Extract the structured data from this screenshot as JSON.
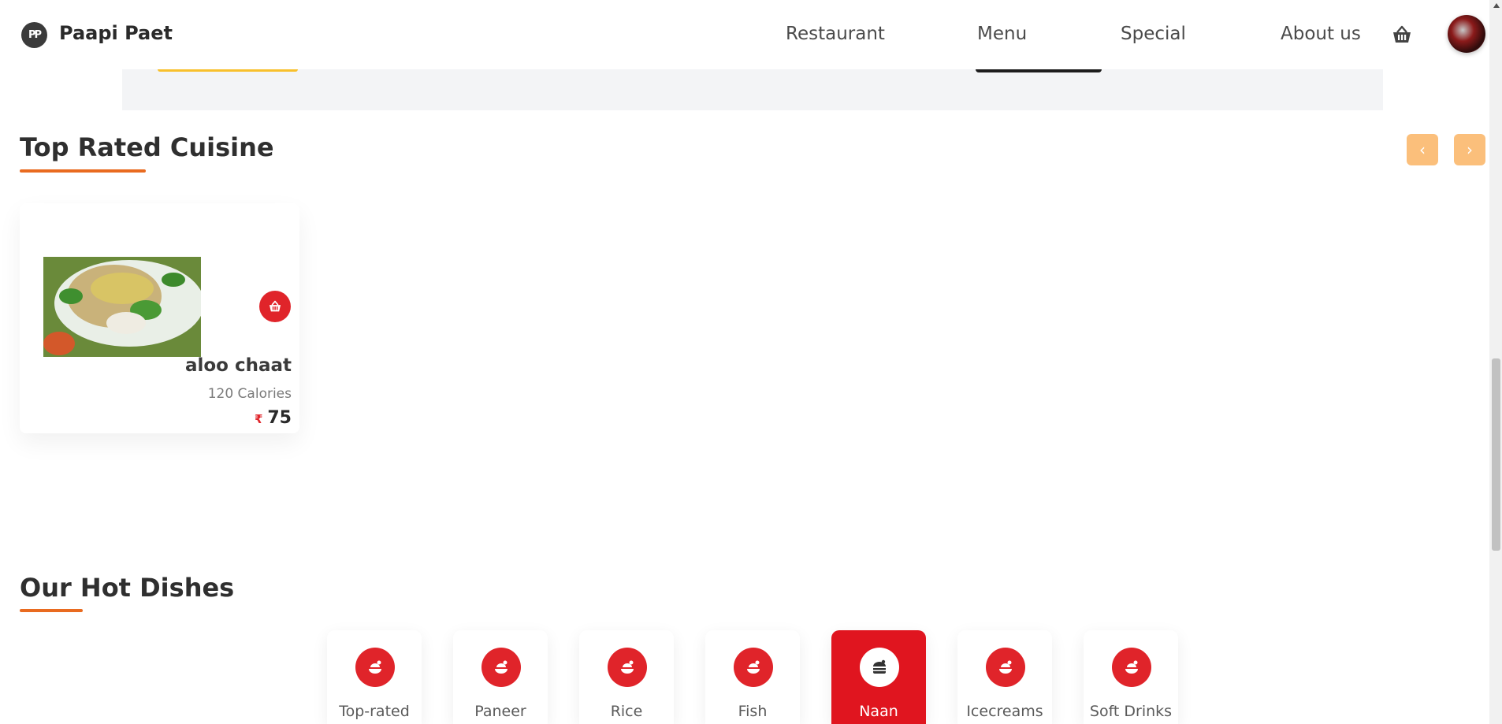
{
  "header": {
    "logo_letters": "PP",
    "brand": "Paapi Paet",
    "nav": [
      "Restaurant",
      "Menu",
      "Special",
      "About us"
    ]
  },
  "top_rated": {
    "title": "Top Rated Cuisine",
    "prev_arrow": "‹",
    "next_arrow": "›",
    "dish": {
      "name": "aloo chaat",
      "calories": "120 Calories",
      "currency": "₹",
      "price": "75"
    }
  },
  "hot_dishes": {
    "title": "Our Hot Dishes",
    "categories": [
      "Top-rated",
      "Paneer",
      "Rice",
      "Fish",
      "Naan",
      "Icecreams",
      "Soft Drinks"
    ],
    "active_category": "Naan"
  },
  "colors": {
    "accent": "#e0242a",
    "underline": "#e96b20",
    "arrow_bg": "#fbbf7b"
  }
}
